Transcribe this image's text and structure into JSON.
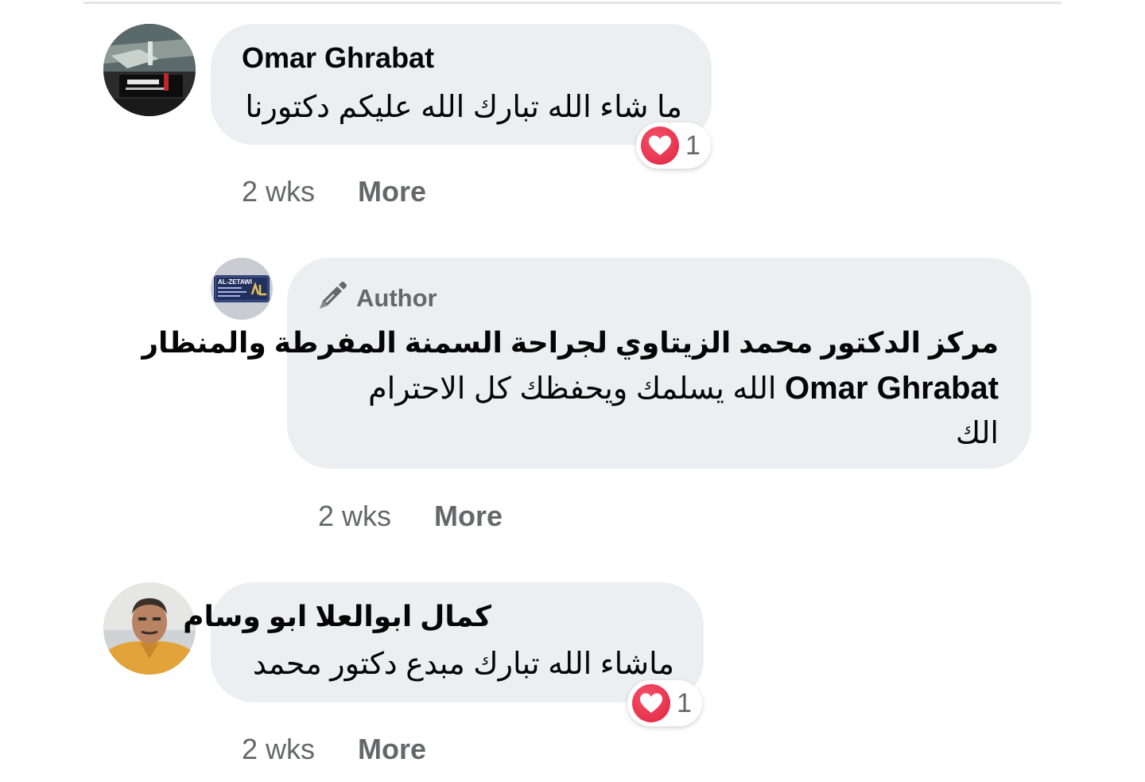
{
  "comments": [
    {
      "author": "Omar Ghrabat",
      "text": "ما شاء الله تبارك الله عليكم دكتورنا",
      "avatar_icon": "page-logo-avatar",
      "reaction": {
        "icon": "heart-icon",
        "count": "1"
      },
      "time": "2 wks",
      "more_label": "More"
    },
    {
      "badge_icon": "pencil-icon",
      "badge_label": "Author",
      "author": "مركز الدكتور محمد الزيتاوي لجراحة السمنة المفرطة والمنظار",
      "mention": "Omar Ghrabat",
      "text": "الله يسلمك ويحفظك كل الاحترام",
      "text_tail": "الك",
      "avatar_icon": "al-zetawi-logo",
      "avatar_text": "AL-ZETAWI",
      "time": "2 wks",
      "more_label": "More"
    },
    {
      "author": "كمال ابوالعلا ابو وسام",
      "text": "ماشاء الله تبارك مبدع دكتور محمد",
      "avatar_icon": "user-photo-avatar",
      "reaction": {
        "icon": "heart-icon",
        "count": "1"
      },
      "time": "2 wks",
      "more_label": "More"
    }
  ],
  "colors": {
    "bubble": "#eceef1",
    "secondary_text": "#65676b",
    "heart": "#e0223f"
  }
}
